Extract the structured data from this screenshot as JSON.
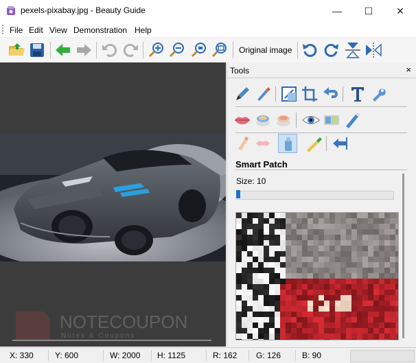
{
  "window": {
    "title": "pexels-pixabay.jpg - Beauty Guide",
    "minimize_icon": "minimize-icon",
    "maximize_icon": "maximize-icon",
    "close_icon": "close-icon"
  },
  "menu": [
    "File",
    "Edit",
    "View",
    "Demonstration",
    "Help"
  ],
  "toolbar": {
    "buttons": [
      "open-folder-icon",
      "save-icon",
      "back-arrow-icon",
      "forward-arrow-icon",
      "undo-icon",
      "redo-icon",
      "zoom-in-icon",
      "zoom-out-icon",
      "zoom-fit-icon",
      "zoom-actual-icon",
      "rotate-left-icon",
      "rotate-right-icon",
      "flip-vertical-icon",
      "flip-horizontal-icon"
    ],
    "original_label": "Original image"
  },
  "panel": {
    "title": "Tools",
    "close_label": "×",
    "tool_title": "Smart Patch",
    "size_label": "Size: 10",
    "size_value": 10
  },
  "watermark": {
    "text": "NOTECOUPON",
    "sub": "Notes & Coupons"
  },
  "status": {
    "x": "X: 330",
    "y": "Y: 600",
    "w": "W: 2000",
    "h": "H: 1125",
    "r": "R: 162",
    "g": "G: 126",
    "b": "B: 90"
  },
  "colors": {
    "accent": "#1f6fd6",
    "canvas_bg": "#3c3c3c",
    "car_body": "#4a4e54",
    "car_stripe": "#2aa0e0"
  }
}
